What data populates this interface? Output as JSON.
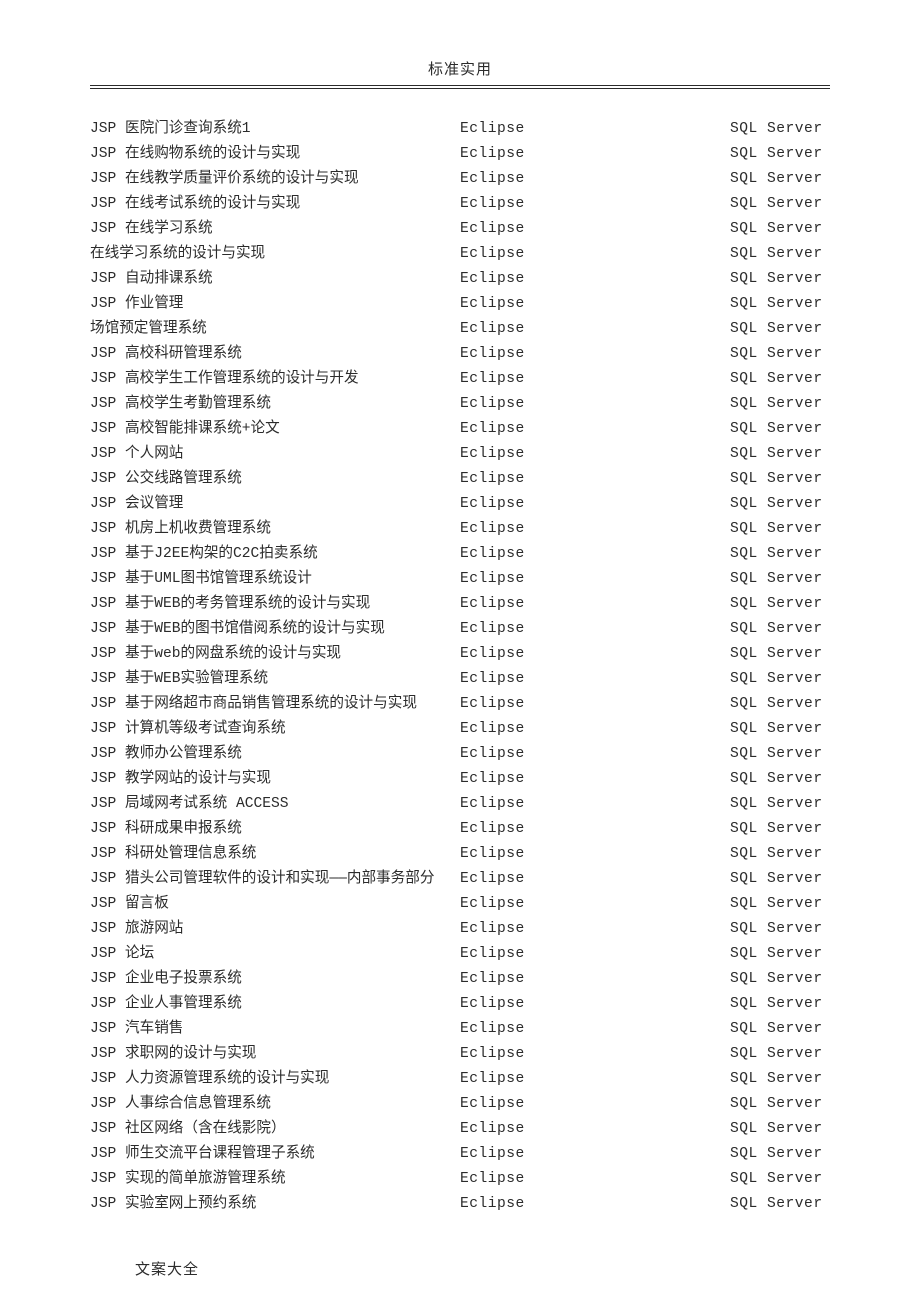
{
  "header": "标准实用",
  "footer": "文案大全",
  "columns": {
    "tool": "Eclipse",
    "db": "SQL Server"
  },
  "rows": [
    {
      "name": "JSP 医院门诊查询系统1",
      "tool": "Eclipse",
      "db": "SQL Server"
    },
    {
      "name": "JSP 在线购物系统的设计与实现",
      "tool": "Eclipse",
      "db": "SQL Server"
    },
    {
      "name": "JSP 在线教学质量评价系统的设计与实现",
      "tool": "Eclipse",
      "db": "SQL Server"
    },
    {
      "name": "JSP 在线考试系统的设计与实现",
      "tool": "Eclipse",
      "db": "SQL Server"
    },
    {
      "name": "JSP 在线学习系统",
      "tool": "Eclipse",
      "db": "SQL Server"
    },
    {
      "name": "在线学习系统的设计与实现",
      "tool": "Eclipse",
      "db": "SQL Server"
    },
    {
      "name": "JSP 自动排课系统",
      "tool": "Eclipse",
      "db": "SQL Server"
    },
    {
      "name": "JSP 作业管理",
      "tool": "Eclipse",
      "db": "SQL Server"
    },
    {
      "name": "场馆预定管理系统",
      "tool": "Eclipse",
      "db": "SQL Server"
    },
    {
      "name": "JSP 高校科研管理系统",
      "tool": "Eclipse",
      "db": "SQL Server"
    },
    {
      "name": "JSP 高校学生工作管理系统的设计与开发",
      "tool": "Eclipse",
      "db": "SQL Server"
    },
    {
      "name": "JSP 高校学生考勤管理系统",
      "tool": "Eclipse",
      "db": "SQL Server"
    },
    {
      "name": "JSP 高校智能排课系统+论文",
      "tool": "Eclipse",
      "db": "SQL Server"
    },
    {
      "name": "JSP 个人网站",
      "tool": "Eclipse",
      "db": "SQL Server"
    },
    {
      "name": "JSP 公交线路管理系统",
      "tool": "Eclipse",
      "db": "SQL Server"
    },
    {
      "name": "JSP 会议管理",
      "tool": "Eclipse",
      "db": "SQL Server"
    },
    {
      "name": "JSP 机房上机收费管理系统",
      "tool": "Eclipse",
      "db": "SQL Server"
    },
    {
      "name": "JSP 基于J2EE构架的C2C拍卖系统",
      "tool": "Eclipse",
      "db": "SQL Server"
    },
    {
      "name": "JSP 基于UML图书馆管理系统设计",
      "tool": "Eclipse",
      "db": "SQL Server"
    },
    {
      "name": "JSP 基于WEB的考务管理系统的设计与实现",
      "tool": "Eclipse",
      "db": "SQL Server"
    },
    {
      "name": "JSP 基于WEB的图书馆借阅系统的设计与实现",
      "tool": "Eclipse",
      "db": "SQL Server"
    },
    {
      "name": "JSP 基于web的网盘系统的设计与实现",
      "tool": "Eclipse",
      "db": "SQL Server"
    },
    {
      "name": "JSP 基于WEB实验管理系统",
      "tool": "Eclipse",
      "db": "SQL Server"
    },
    {
      "name": "JSP 基于网络超市商品销售管理系统的设计与实现",
      "tool": "Eclipse",
      "db": "SQL Server"
    },
    {
      "name": "JSP 计算机等级考试查询系统",
      "tool": "Eclipse",
      "db": "SQL Server"
    },
    {
      "name": "JSP 教师办公管理系统",
      "tool": "Eclipse",
      "db": "SQL Server"
    },
    {
      "name": "JSP 教学网站的设计与实现",
      "tool": "Eclipse",
      "db": "SQL Server"
    },
    {
      "name": "JSP 局域网考试系统 ACCESS",
      "tool": "Eclipse",
      "db": "SQL Server"
    },
    {
      "name": "JSP 科研成果申报系统",
      "tool": "Eclipse",
      "db": "SQL Server"
    },
    {
      "name": "JSP 科研处管理信息系统",
      "tool": "Eclipse",
      "db": "SQL Server"
    },
    {
      "name": "JSP 猎头公司管理软件的设计和实现——内部事务部分",
      "tool": "Eclipse",
      "db": "SQL Server"
    },
    {
      "name": "JSP 留言板",
      "tool": "Eclipse",
      "db": "SQL Server"
    },
    {
      "name": "JSP 旅游网站",
      "tool": "Eclipse",
      "db": "SQL Server"
    },
    {
      "name": "JSP 论坛",
      "tool": "Eclipse",
      "db": "SQL Server"
    },
    {
      "name": "JSP 企业电子投票系统",
      "tool": "Eclipse",
      "db": "SQL Server"
    },
    {
      "name": "JSP 企业人事管理系统",
      "tool": "Eclipse",
      "db": "SQL Server"
    },
    {
      "name": "JSP 汽车销售",
      "tool": "Eclipse",
      "db": "SQL Server"
    },
    {
      "name": "JSP 求职网的设计与实现",
      "tool": "Eclipse",
      "db": "SQL Server"
    },
    {
      "name": "JSP 人力资源管理系统的设计与实现",
      "tool": "Eclipse",
      "db": "SQL Server"
    },
    {
      "name": "JSP 人事综合信息管理系统",
      "tool": "Eclipse",
      "db": "SQL Server"
    },
    {
      "name": "JSP 社区网络（含在线影院）",
      "tool": "Eclipse",
      "db": "SQL Server"
    },
    {
      "name": "JSP 师生交流平台课程管理子系统",
      "tool": "Eclipse",
      "db": "SQL Server"
    },
    {
      "name": "JSP 实现的简单旅游管理系统",
      "tool": "Eclipse",
      "db": "SQL Server"
    },
    {
      "name": "JSP 实验室网上预约系统",
      "tool": "Eclipse",
      "db": "SQL Server"
    }
  ]
}
